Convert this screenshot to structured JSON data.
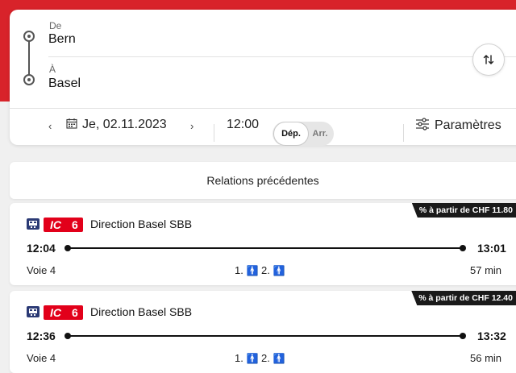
{
  "search": {
    "from_label": "De",
    "from_value": "Bern",
    "to_label": "À",
    "to_value": "Basel",
    "date": "Je, 02.11.2023",
    "time": "12:00",
    "toggle_departure": "Dép.",
    "toggle_arrival": "Arr.",
    "settings_label": "Paramètres"
  },
  "previous_connections_label": "Relations précédentes",
  "connections": [
    {
      "price": "% à partir de CHF 11.80",
      "train_type": "IC",
      "train_number": "6",
      "direction": "Direction Basel SBB",
      "departure": "12:04",
      "arrival": "13:01",
      "platform": "Voie 4",
      "first_class": "1.",
      "second_class": "2.",
      "duration": "57 min"
    },
    {
      "price": "% à partir de CHF 12.40",
      "train_type": "IC",
      "train_number": "6",
      "direction": "Direction Basel SBB",
      "departure": "12:36",
      "arrival": "13:32",
      "platform": "Voie 4",
      "first_class": "1.",
      "second_class": "2.",
      "duration": "56 min"
    }
  ],
  "colors": {
    "brand_red": "#d8232a",
    "ic_red": "#e2001a",
    "train_icon_blue": "#2b3a75"
  },
  "icons": [
    "route-start-icon",
    "route-end-icon",
    "swap-icon",
    "calendar-icon",
    "chevron-left-icon",
    "chevron-right-icon",
    "settings-sliders-icon",
    "train-icon",
    "occupancy-icon"
  ]
}
